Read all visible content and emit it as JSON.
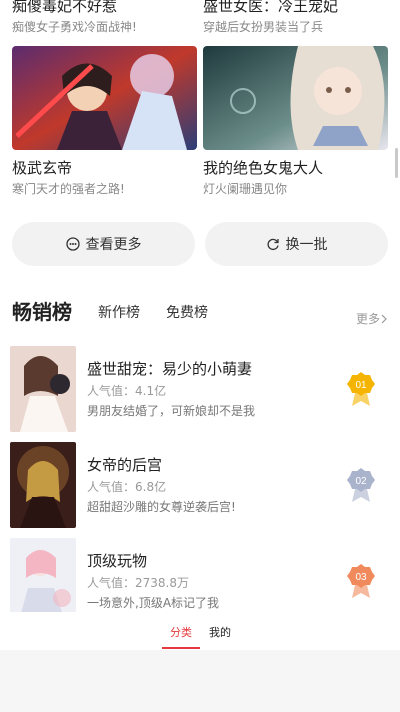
{
  "top_cards": [
    {
      "title": "痴傻毒妃不好惹",
      "desc": "痴傻女子勇戏冷面战神!"
    },
    {
      "title": "盛世女医：冷王宠妃",
      "desc": "穿越后女扮男装当了兵"
    }
  ],
  "cards": [
    {
      "title": "极武玄帝",
      "desc": "寒门天才的强者之路!"
    },
    {
      "title": "我的绝色女鬼大人",
      "desc": "灯火阑珊遇见你"
    }
  ],
  "actions": {
    "more_label": "查看更多",
    "refresh_label": "换一批"
  },
  "ranks": {
    "tabs": [
      "畅销榜",
      "新作榜",
      "免费榜"
    ],
    "more_label": "更多",
    "items": [
      {
        "title": "盛世甜宠：易少的小萌妻",
        "popularity": "人气值：4.1亿",
        "desc": "男朋友结婚了，可新娘却不是我",
        "rank": "01",
        "medal_color": "#f5b400"
      },
      {
        "title": "女帝的后宫",
        "popularity": "人气值：6.8亿",
        "desc": "超甜超沙雕的女尊逆袭后宫!",
        "rank": "02",
        "medal_color": "#aab3cc"
      },
      {
        "title": "顶级玩物",
        "popularity": "人气值：2738.8万",
        "desc": "一场意外,顶级A标记了我",
        "rank": "03",
        "medal_color": "#f08a5d"
      }
    ]
  },
  "tabbar": {
    "categories_label": "分类",
    "mine_label": "我的",
    "accent": "#e4393c"
  }
}
